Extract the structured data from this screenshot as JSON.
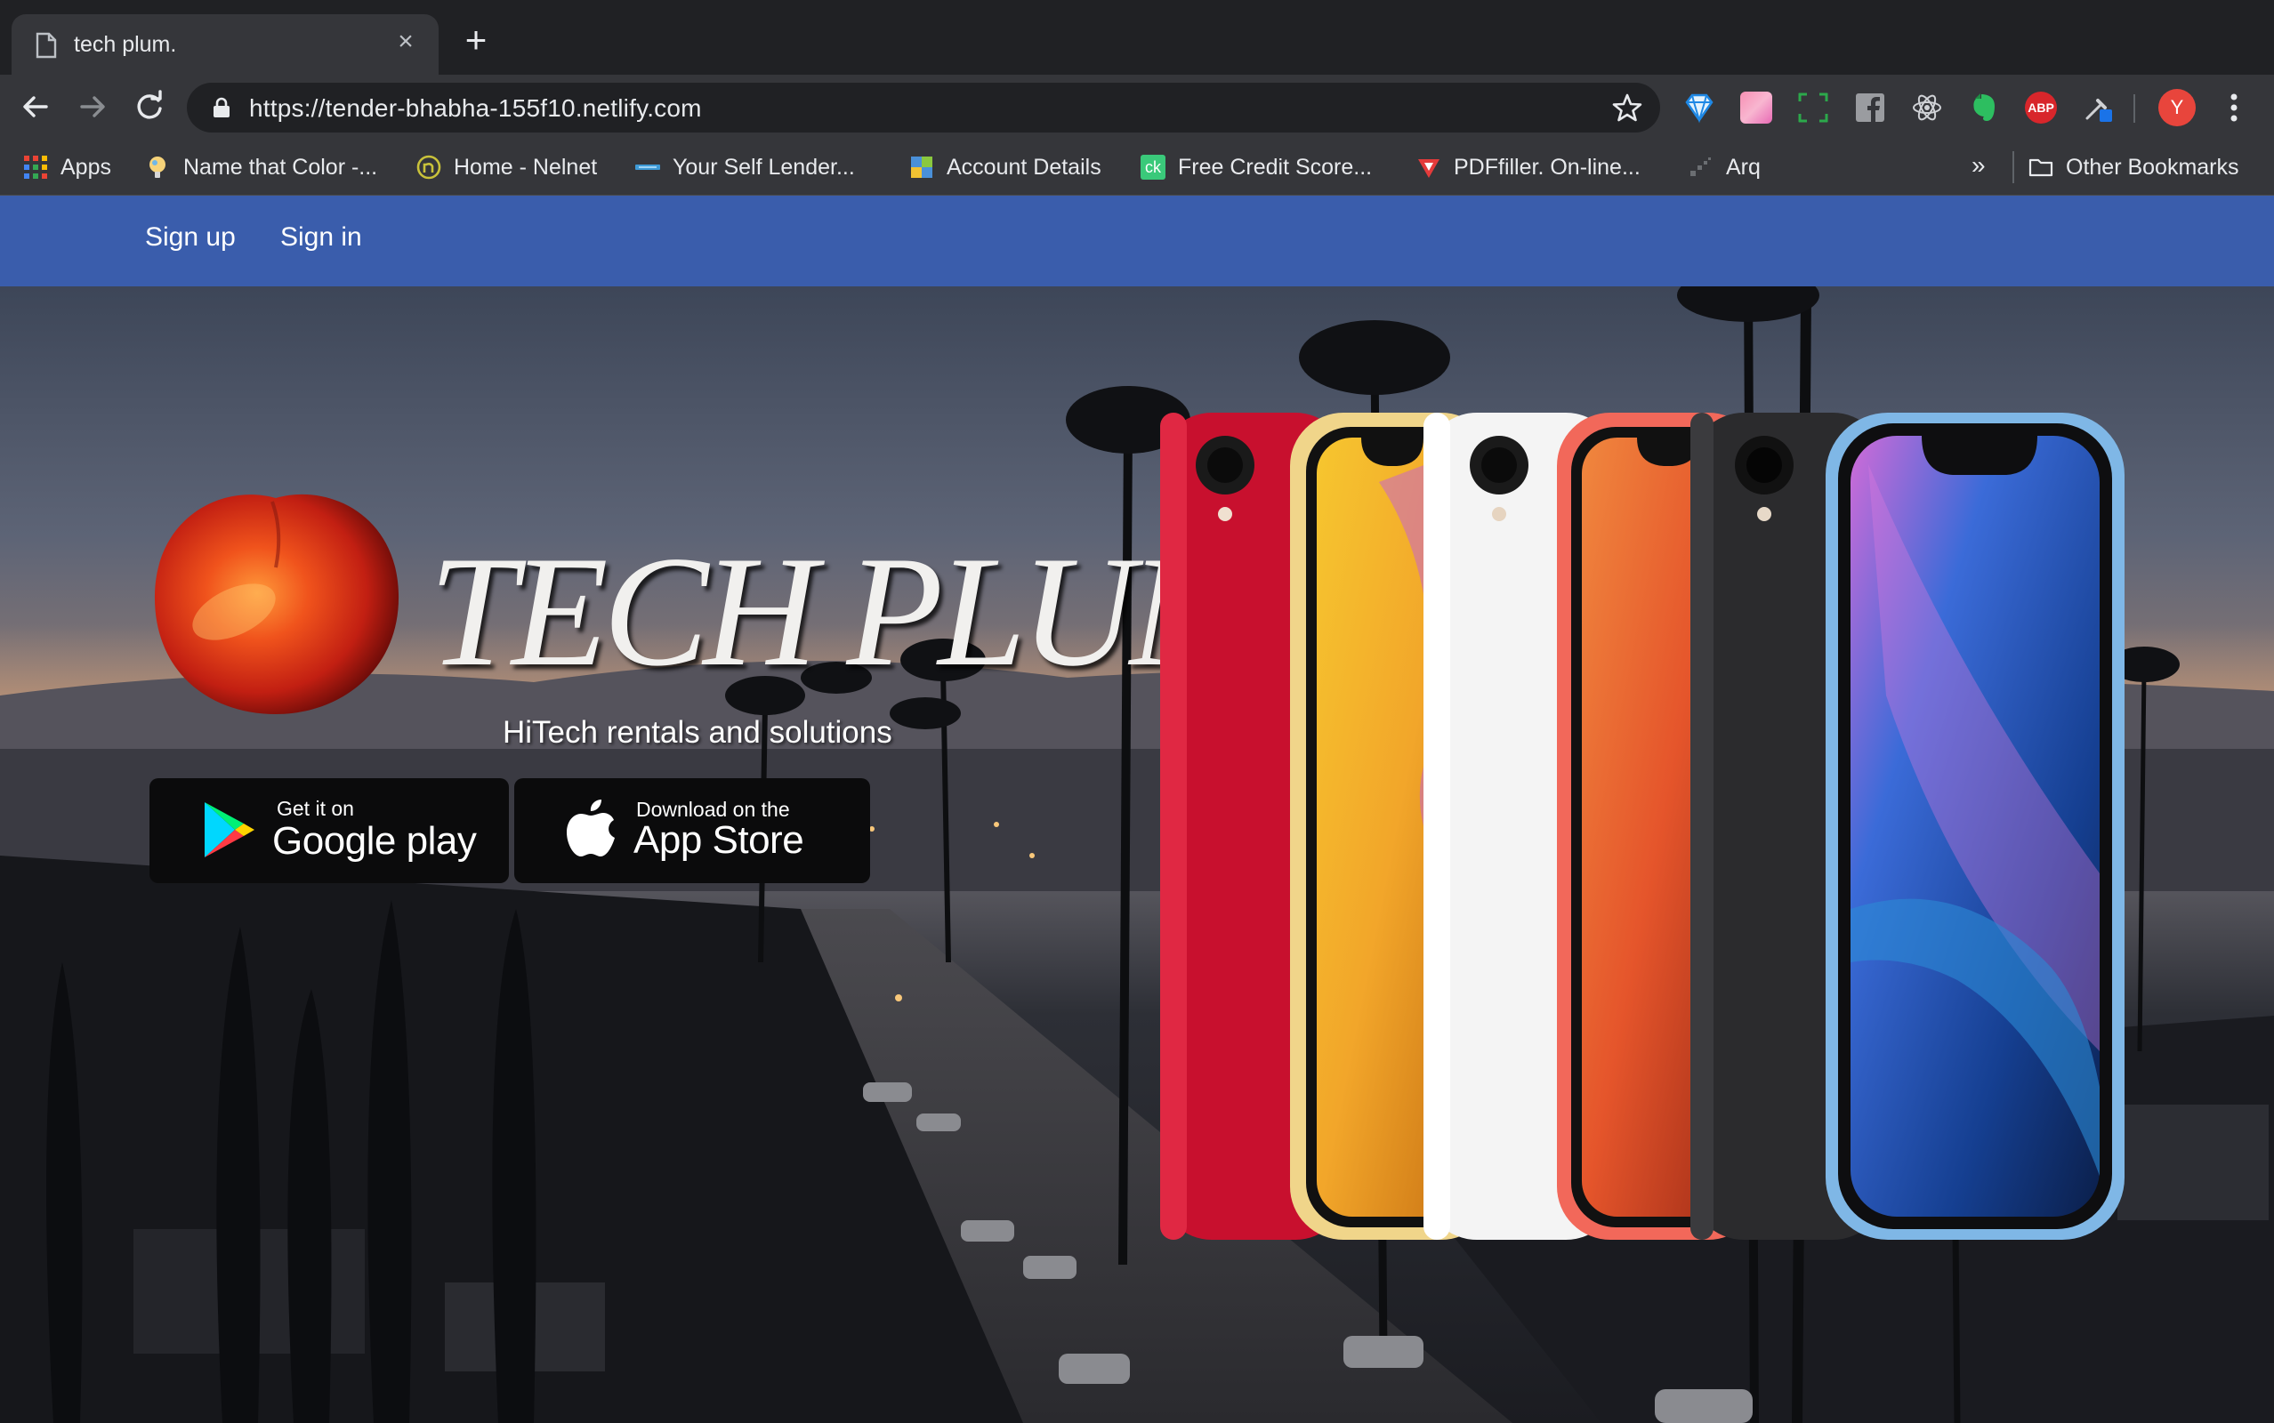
{
  "browser": {
    "tab_title": "tech plum.",
    "url": "https://tender-bhabha-155f10.netlify.com",
    "profile_initial": "Y",
    "extensions": [
      "sapphire-icon",
      "pink-gradient-icon",
      "screenshot-icon",
      "facebook-icon",
      "react-icon",
      "evernote-icon",
      "adblock-icon",
      "eyedropper-icon"
    ],
    "adblock_label": "ABP"
  },
  "bookmarks": {
    "items": [
      {
        "label": "Apps",
        "icon": "apps-grid-icon"
      },
      {
        "label": "Name that Color -...",
        "icon": "color-bulb-icon"
      },
      {
        "label": "Home - Nelnet",
        "icon": "nelnet-icon"
      },
      {
        "label": "Your Self Lender...",
        "icon": "selflender-icon"
      },
      {
        "label": "Account Details",
        "icon": "account-icon"
      },
      {
        "label": "Free Credit Score...",
        "icon": "creditkarma-icon",
        "badge": "ck"
      },
      {
        "label": "PDFfiller. On-line...",
        "icon": "pdffiller-icon"
      },
      {
        "label": "Arq",
        "icon": "arq-icon"
      }
    ],
    "more": "»",
    "other": "Other Bookmarks"
  },
  "page": {
    "nav": {
      "signup": "Sign up",
      "signin": "Sign in"
    },
    "logo_text": "TECH PLUM",
    "tagline": "HiTech rentals and solutions",
    "google_play": {
      "small": "Get it on",
      "big": "Google play"
    },
    "app_store": {
      "small": "Download on the",
      "big": "App Store"
    }
  },
  "colors": {
    "navbar": "#3a5dac",
    "phone_colors": [
      "#c8102e",
      "#f3c53f",
      "#f5f5f5",
      "#f2685a",
      "#2b2b2d",
      "#4a9be0"
    ]
  }
}
